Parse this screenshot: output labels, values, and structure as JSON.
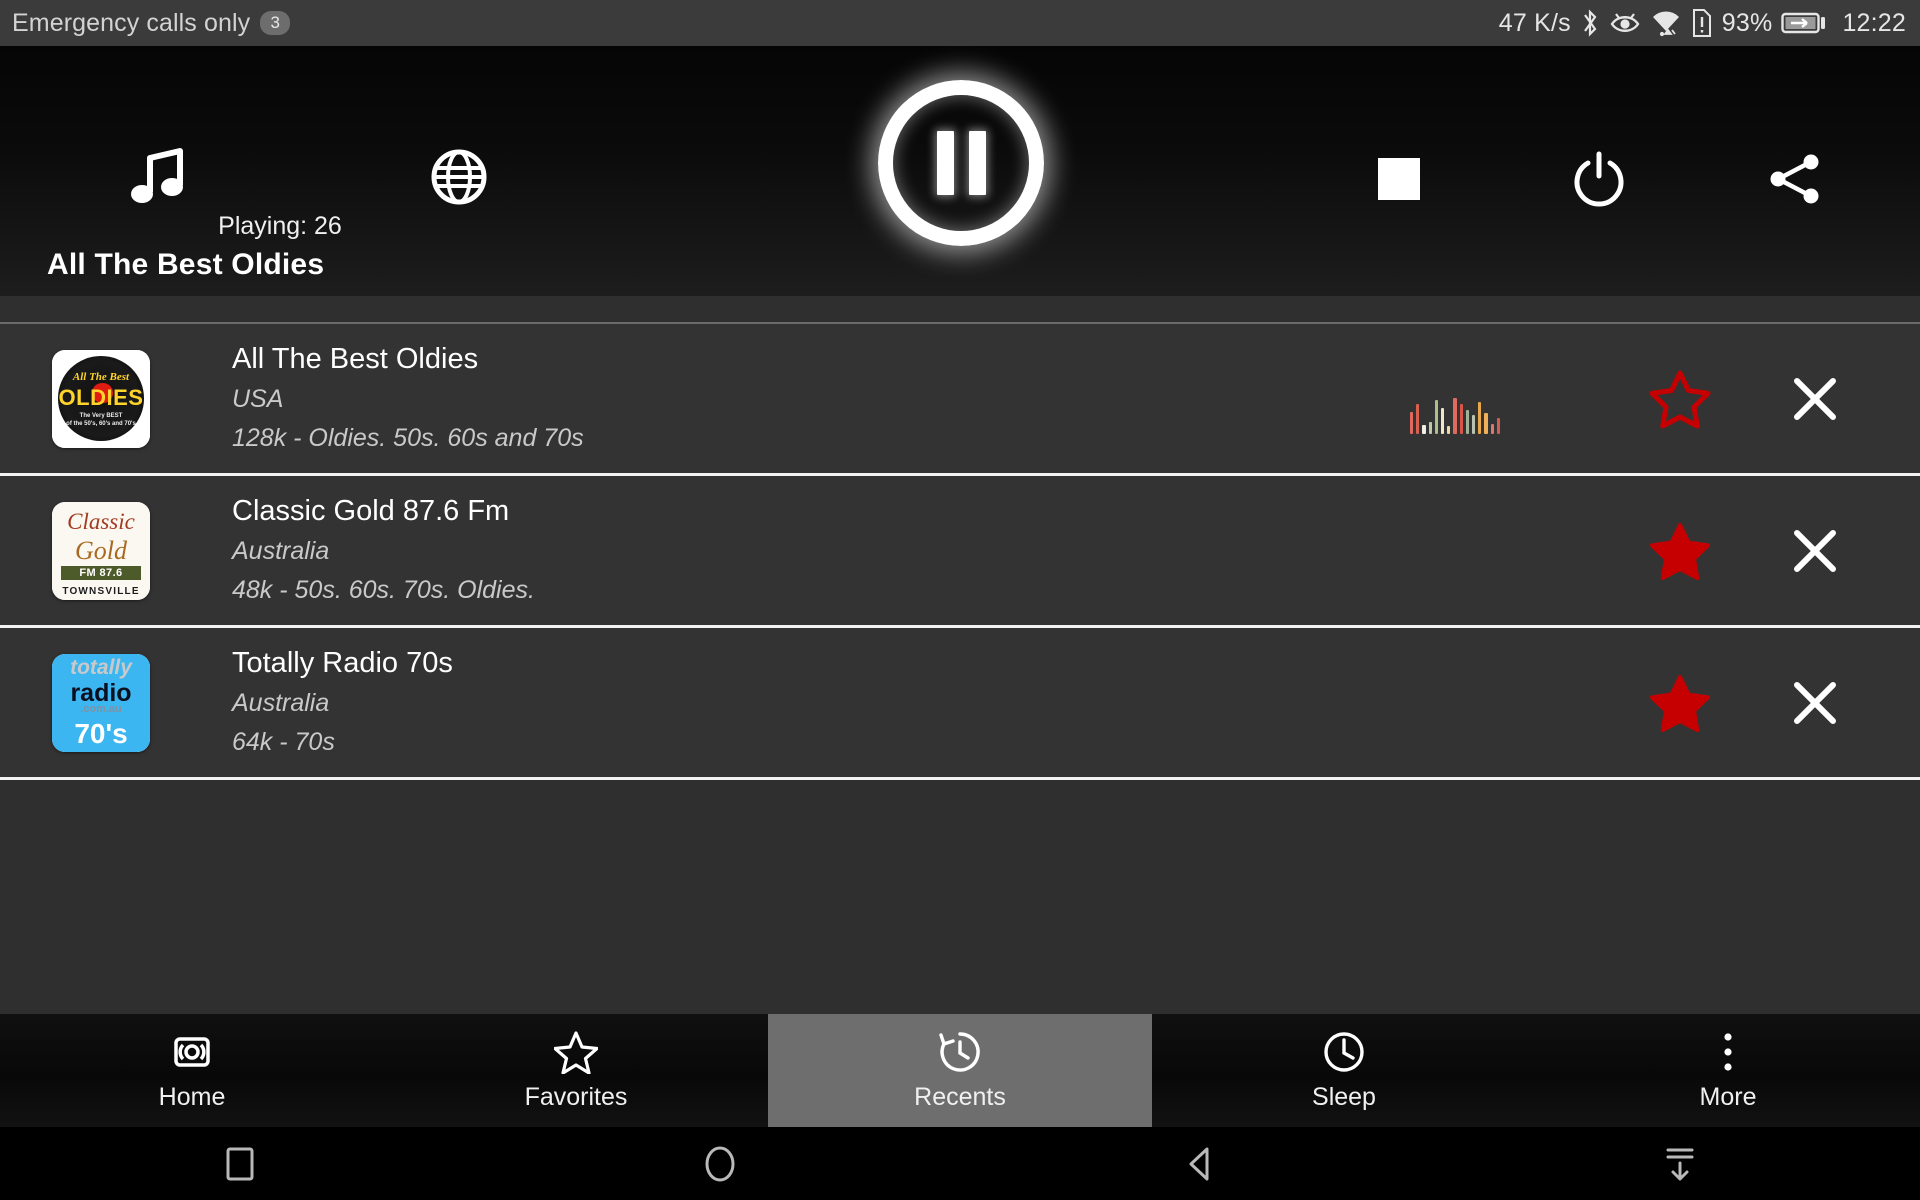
{
  "statusbar": {
    "carrier_text": "Emergency calls only",
    "notification_count": "3",
    "network_speed": "47 K/s",
    "battery_percent": "93%",
    "clock": "12:22",
    "icons": [
      "bluetooth-icon",
      "eye-icon",
      "wifi-icon",
      "sim-alert-icon",
      "battery-charging-icon"
    ]
  },
  "player": {
    "music_icon": "music-note-icon",
    "globe_icon": "globe-icon",
    "playing_label": "Playing: 26",
    "transport_state": "pause-icon",
    "stop_icon": "stop-icon",
    "power_icon": "power-icon",
    "share_icon": "share-icon"
  },
  "section": {
    "title": "All The Best Oldies"
  },
  "stations": [
    {
      "name": "All The Best Oldies",
      "country": "USA",
      "description": "128k - Oldies. 50s. 60s and 70s",
      "favorite": false,
      "now_playing": true,
      "logo": {
        "style": "oldies",
        "line1": "All The Best",
        "line2": "OLDIES",
        "line3": "The Very BEST<br>of the 50's, 60's and 70's"
      },
      "equalizer_bars": [
        22,
        30,
        9,
        12,
        34,
        26,
        8,
        36,
        30,
        24,
        19,
        32,
        21,
        10,
        16
      ],
      "equalizer_colors": [
        "#e0695e",
        "#d9604f",
        "#f0efe6",
        "#bfc9a8",
        "#a9bf8c",
        "#efe7c7",
        "#ecd9a8",
        "#e06a5e",
        "#d9554a",
        "#9fb39a",
        "#b9c4b0",
        "#e8a84a",
        "#efb05a",
        "#d97a6a",
        "#cf5f50"
      ],
      "star_state": "star-outline",
      "close_label": "close-icon"
    },
    {
      "name": "Classic Gold 87.6 Fm",
      "country": "Australia",
      "description": "48k - 50s. 60s. 70s. Oldies.",
      "favorite": true,
      "now_playing": false,
      "logo": {
        "style": "classic-gold",
        "line1": "Classic",
        "line2": "Gold",
        "line3": "FM 87.6",
        "line4": "TOWNSVILLE"
      },
      "star_state": "star-filled",
      "close_label": "close-icon"
    },
    {
      "name": "Totally Radio 70s",
      "country": "Australia",
      "description": "64k - 70s",
      "favorite": true,
      "now_playing": false,
      "logo": {
        "style": "totally-radio",
        "line1": "totally",
        "line2": "radio",
        "line3": ".com.au",
        "line4": "70's"
      },
      "star_state": "star-filled",
      "close_label": "close-icon"
    }
  ],
  "bottom_nav": {
    "active_index": 2,
    "items": [
      {
        "label": "Home",
        "icon": "radio-broadcast-icon"
      },
      {
        "label": "Favorites",
        "icon": "star-outline-icon"
      },
      {
        "label": "Recents",
        "icon": "history-icon"
      },
      {
        "label": "Sleep",
        "icon": "clock-icon"
      },
      {
        "label": "More",
        "icon": "overflow-menu-icon"
      }
    ]
  },
  "system_nav": {
    "items": [
      "recents-square-icon",
      "home-circle-icon",
      "back-triangle-icon",
      "hide-navbar-icon"
    ]
  },
  "colors": {
    "accent_red": "#c60000",
    "row_background": "#333333",
    "separator": "#f2f2f2",
    "active_nav": "#6e6e6e"
  }
}
